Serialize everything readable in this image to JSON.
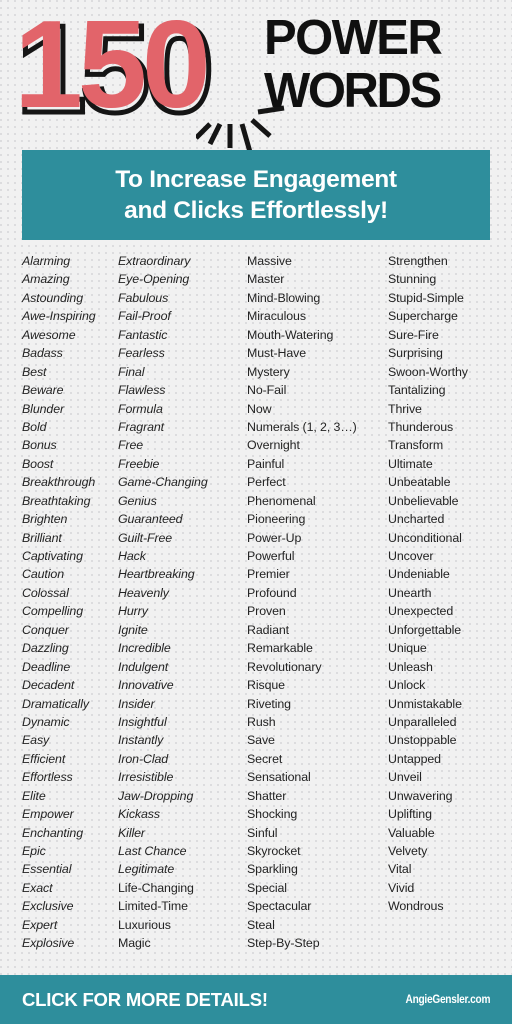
{
  "header": {
    "number": "150",
    "title_line_1": "POWER",
    "title_line_2": "WORDS",
    "number_color": "#e2646a",
    "title_color": "#101010"
  },
  "banner": {
    "line_1": "To Increase Engagement",
    "line_2": "and Clicks Effortlessly!",
    "background_color": "#2e8e9c",
    "text_color": "#ffffff"
  },
  "footer": {
    "cta": "CLICK FOR MORE DETAILS!",
    "site": "AngieGensler.com",
    "background_color": "#2e8e9c",
    "text_color": "#ffffff"
  },
  "page": {
    "background_color": "#f1f1f1",
    "total_words": 150
  },
  "columns": [
    {
      "index": 0,
      "style": "italic",
      "words": [
        "Alarming",
        "Amazing",
        "Astounding",
        "Awe-Inspiring",
        "Awesome",
        "Badass",
        "Best",
        "Beware",
        "Blunder",
        "Bold",
        "Bonus",
        "Boost",
        "Breakthrough",
        "Breathtaking",
        "Brighten",
        "Brilliant",
        "Captivating",
        "Caution",
        "Colossal",
        "Compelling",
        "Conquer",
        "Dazzling",
        "Deadline",
        "Decadent",
        "Dramatically",
        "Dynamic",
        "Easy",
        "Efficient",
        "Effortless",
        "Elite",
        "Empower",
        "Enchanting",
        "Epic",
        "Essential",
        "Exact",
        "Exclusive",
        "Expert",
        "Explosive"
      ]
    },
    {
      "index": 1,
      "style": "mixed",
      "italic_count": 34,
      "words": [
        "Extraordinary",
        "Eye-Opening",
        "Fabulous",
        "Fail-Proof",
        "Fantastic",
        "Fearless",
        "Final",
        "Flawless",
        "Formula",
        "Fragrant",
        "Free",
        "Freebie",
        "Game-Changing",
        "Genius",
        "Guaranteed",
        "Guilt-Free",
        "Hack",
        "Heartbreaking",
        "Heavenly",
        "Hurry",
        "Ignite",
        "Incredible",
        "Indulgent",
        "Innovative",
        "Insider",
        "Insightful",
        "Instantly",
        "Iron-Clad",
        "Irresistible",
        "Jaw-Dropping",
        "Kickass",
        "Killer",
        "Last Chance",
        "Legitimate",
        "Life-Changing",
        "Limited-Time",
        "Luxurious",
        "Magic"
      ]
    },
    {
      "index": 2,
      "style": "regular",
      "words": [
        "Massive",
        "Master",
        "Mind-Blowing",
        "Miraculous",
        "Mouth-Watering",
        "Must-Have",
        "Mystery",
        "No-Fail",
        "Now",
        "Numerals (1, 2, 3…)",
        "Overnight",
        "Painful",
        "Perfect",
        "Phenomenal",
        "Pioneering",
        "Power-Up",
        "Powerful",
        "Premier",
        "Profound",
        "Proven",
        "Radiant",
        "Remarkable",
        "Revolutionary",
        "Risque",
        "Riveting",
        "Rush",
        "Save",
        "Secret",
        "Sensational",
        "Shatter",
        "Shocking",
        "Sinful",
        "Skyrocket",
        "Sparkling",
        "Special",
        "Spectacular",
        "Steal",
        "Step-By-Step"
      ]
    },
    {
      "index": 3,
      "style": "regular",
      "words": [
        "Strengthen",
        "Stunning",
        "Stupid-Simple",
        "Supercharge",
        "Sure-Fire",
        "Surprising",
        "Swoon-Worthy",
        "Tantalizing",
        "Thrive",
        "Thunderous",
        "Transform",
        "Ultimate",
        "Unbeatable",
        "Unbelievable",
        "Uncharted",
        "Unconditional",
        "Uncover",
        "Undeniable",
        "Unearth",
        "Unexpected",
        "Unforgettable",
        "Unique",
        "Unleash",
        "Unlock",
        "Unmistakable",
        "Unparalleled",
        "Unstoppable",
        "Untapped",
        "Unveil",
        "Unwavering",
        "Uplifting",
        "Valuable",
        "Velvety",
        "Vital",
        "Vivid",
        "Wondrous"
      ]
    }
  ]
}
